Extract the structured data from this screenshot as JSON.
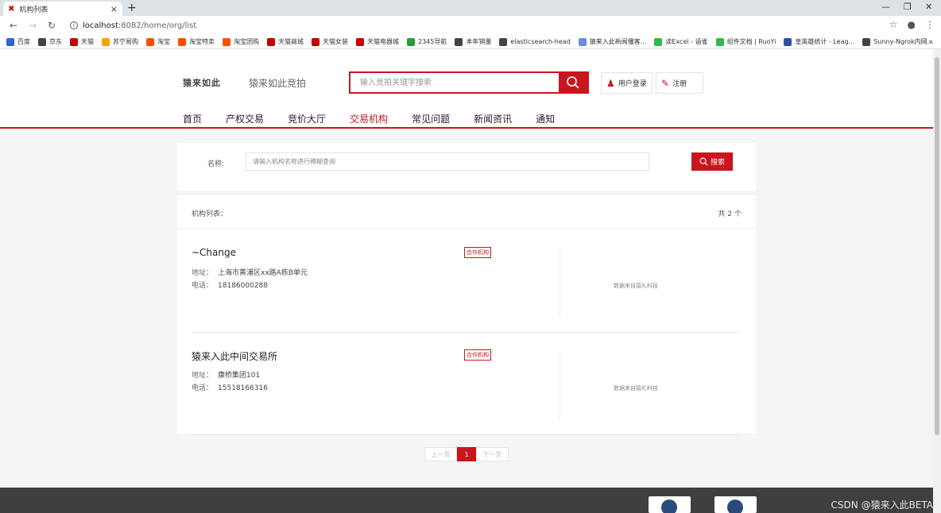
{
  "browser": {
    "tab_title": "机构列表",
    "tab_close": "×",
    "new_tab": "+",
    "url_host": "localhost",
    "url_path": ":8082/home/org/list",
    "bookmarks": [
      {
        "label": "百度",
        "color": "#2b66d9"
      },
      {
        "label": "京东",
        "color": "#444444"
      },
      {
        "label": "天猫",
        "color": "#c40000"
      },
      {
        "label": "苏宁易购",
        "color": "#f5a300"
      },
      {
        "label": "淘宝",
        "color": "#ff5000"
      },
      {
        "label": "淘宝特卖",
        "color": "#ff5000"
      },
      {
        "label": "淘宝团购",
        "color": "#ff5000"
      },
      {
        "label": "天猫商城",
        "color": "#c40000"
      },
      {
        "label": "天猫女装",
        "color": "#c40000"
      },
      {
        "label": "天猫电器城",
        "color": "#c40000"
      },
      {
        "label": "2345导航",
        "color": "#2a9d3a"
      },
      {
        "label": "本年销量",
        "color": "#444444"
      },
      {
        "label": "elasticsearch-head",
        "color": "#444444"
      },
      {
        "label": "猿来入此新闻播客...",
        "color": "#6a8ed9"
      },
      {
        "label": "读Excel - 语雀",
        "color": "#31b94a"
      },
      {
        "label": "组件文档 | RuoYi",
        "color": "#31b94a"
      },
      {
        "label": "皇英雄统计 - Leag...",
        "color": "#2b4fa8"
      },
      {
        "label": "Sunny-Ngrok内网...",
        "color": "#444444"
      }
    ],
    "bookmarks_more": "»"
  },
  "header": {
    "logo": "猿来如此",
    "site_name": "猿来如此竞拍",
    "search_placeholder": "输入竞拍关键字搜索",
    "login_label": "用户登录",
    "register_label": "注册"
  },
  "nav": {
    "items": [
      "首页",
      "产权交易",
      "竞价大厅",
      "交易机构",
      "常见问题",
      "新闻资讯",
      "通知"
    ],
    "active_index": 3
  },
  "filter": {
    "label": "名称:",
    "placeholder": "请输入机构名称进行模糊查询",
    "button_label": "搜索"
  },
  "list": {
    "title": "机构列表：",
    "count": "共 2 个",
    "address_key": "地址：",
    "phone_key": "电话：",
    "orgs": [
      {
        "name": "~Change",
        "badge": "合作机构",
        "address": "上海市黄浦区xx路A栋B单元",
        "phone": "18186000288",
        "source": "数据来自猿礼科技"
      },
      {
        "name": "猿来入此中间交易所",
        "badge": "合作机构",
        "address": "康桥集团101",
        "phone": "15518166316",
        "source": "数据来自猿礼科技"
      }
    ]
  },
  "pager": {
    "prev": "上一页",
    "current": "1",
    "next": "下一页"
  },
  "watermark": "CSDN @猿来入此BETA",
  "colors": {
    "brand_red": "#c9151e",
    "footer_bg": "#3f3f3f"
  }
}
